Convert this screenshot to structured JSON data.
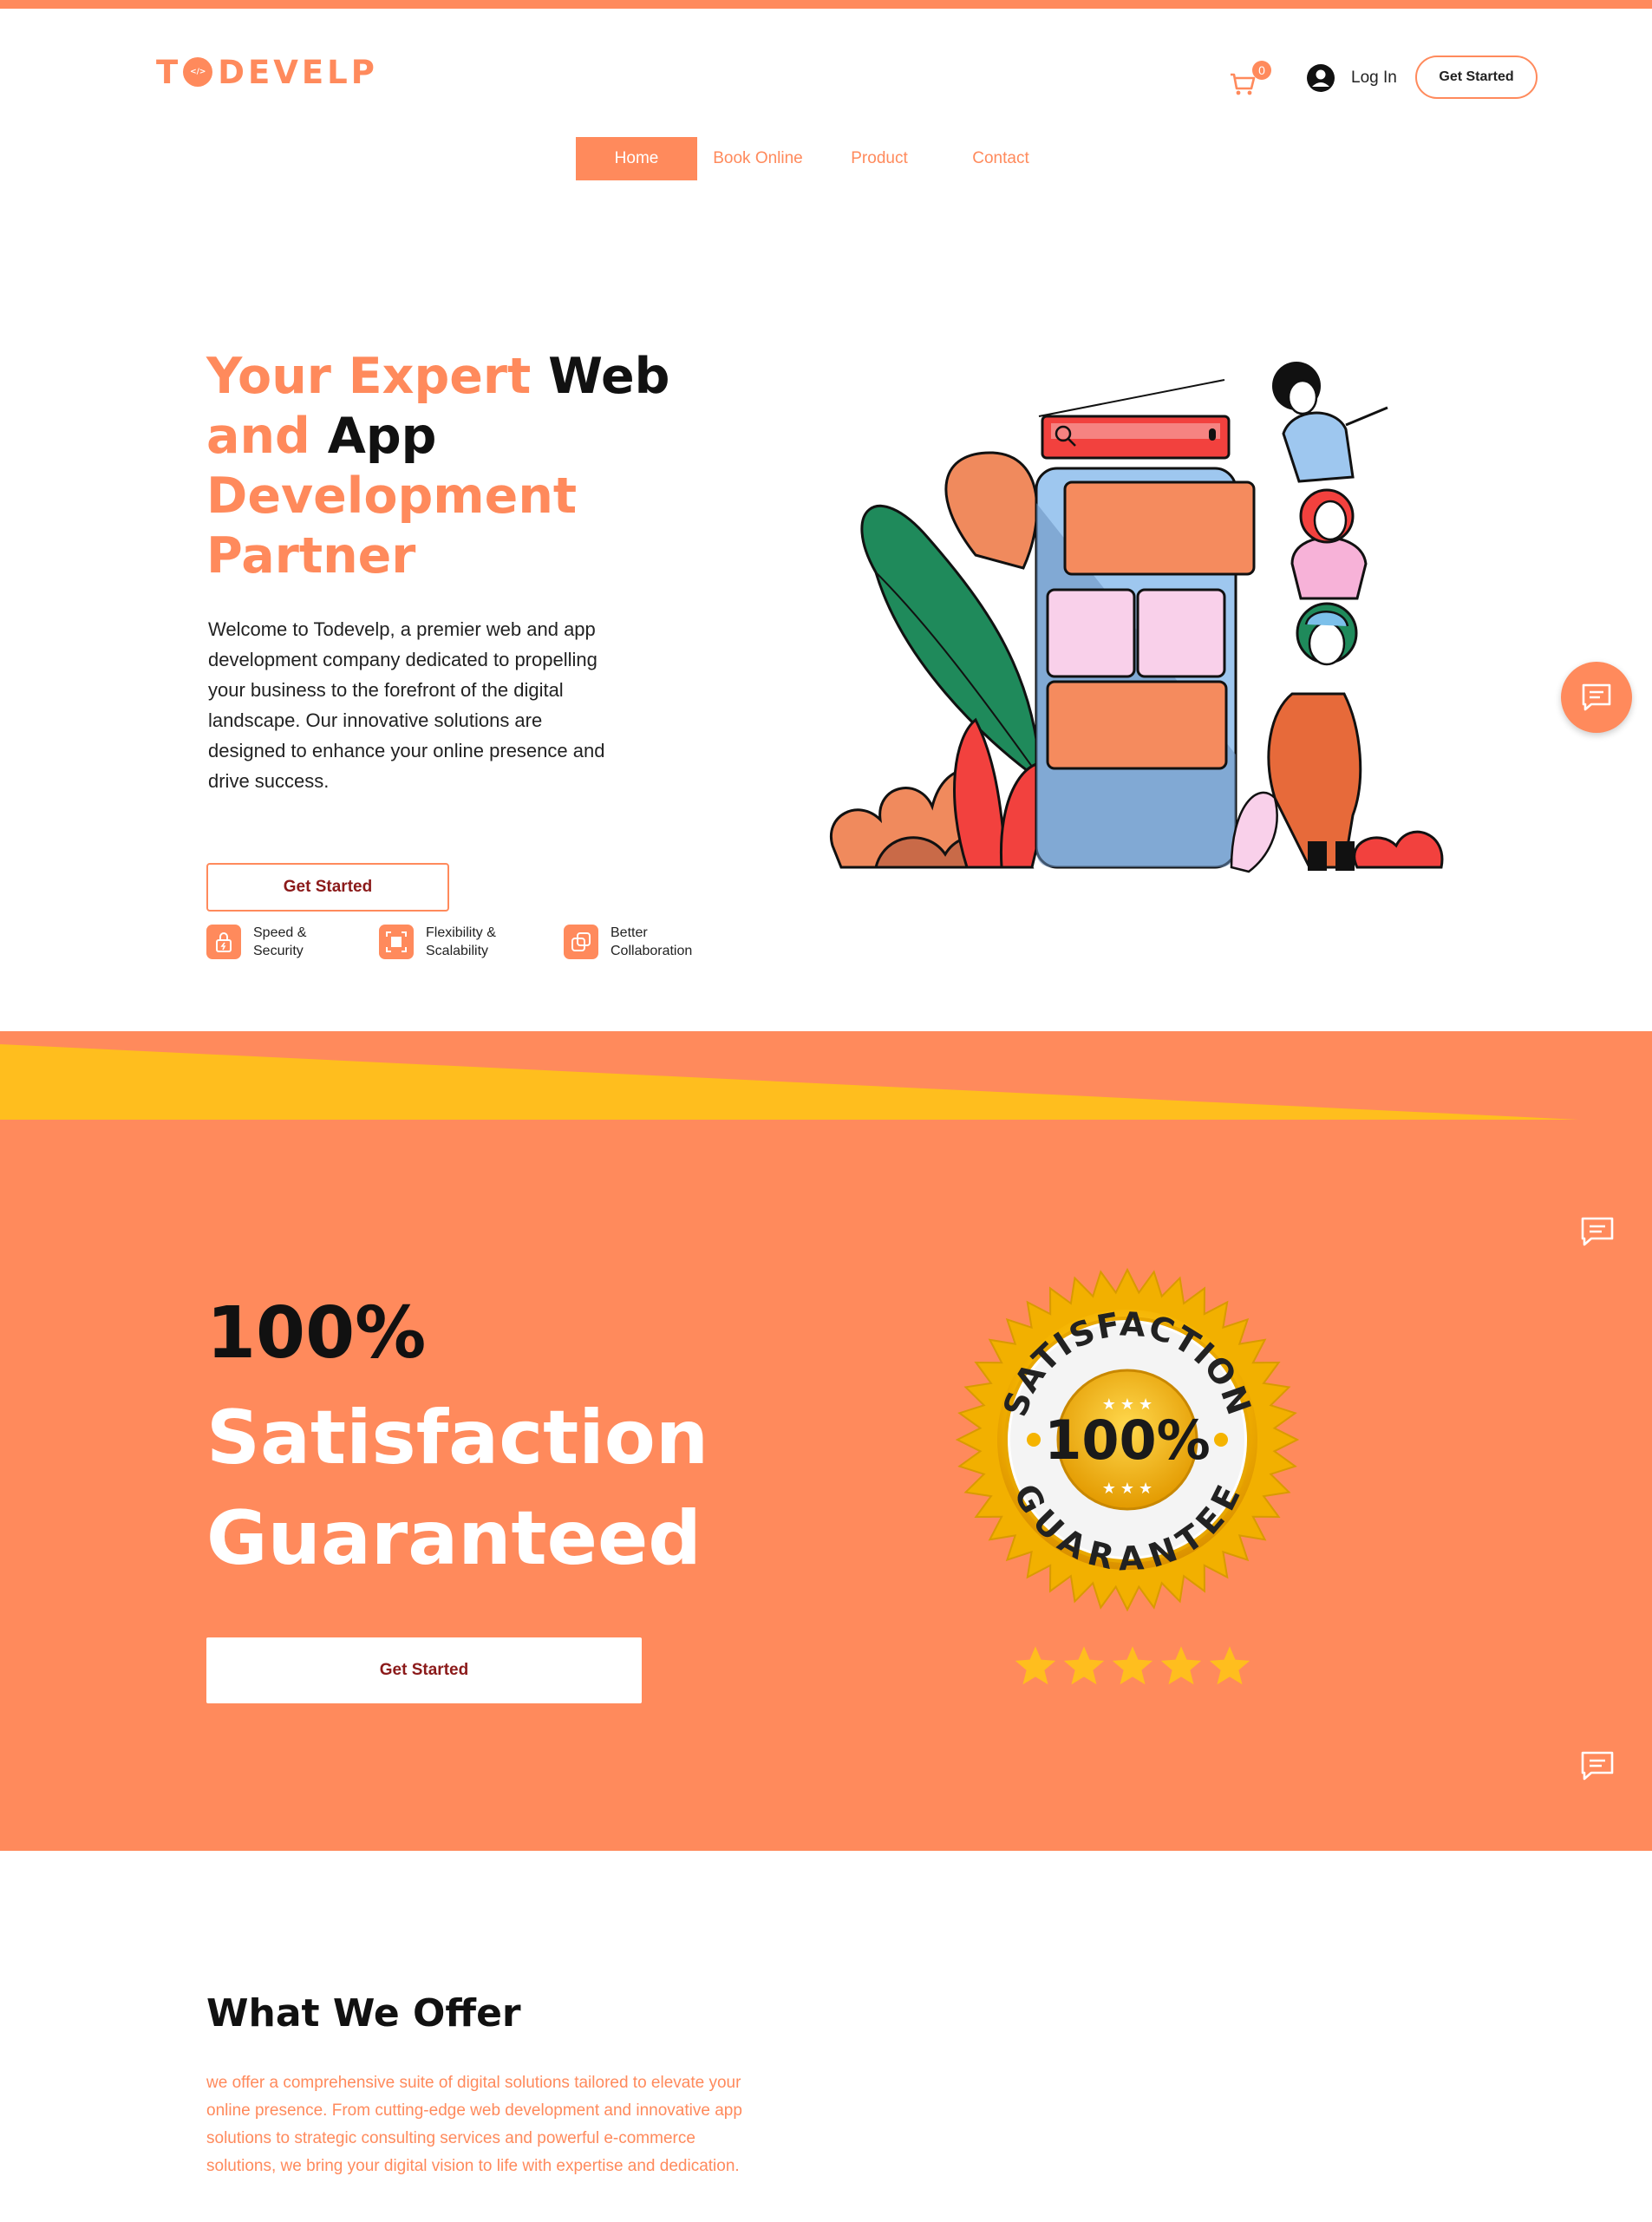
{
  "brand": {
    "logo_prefix": "T",
    "logo_suffix": "DEVELP",
    "logo_mark_text": "</>",
    "accent": "#ff8a5c",
    "yellow": "#ffbe1e"
  },
  "header": {
    "cart_count": "0",
    "login_label": "Log In",
    "cta_label": "Get Started"
  },
  "nav": {
    "items": [
      {
        "label": "Home",
        "active": true
      },
      {
        "label": "Book Online"
      },
      {
        "label": "Product"
      },
      {
        "label": "Contact"
      }
    ]
  },
  "hero": {
    "title_line1_accent": "Your Expert ",
    "title_line1_dark": "Web",
    "title_line2_accent": "and ",
    "title_line2_dark": "App",
    "title_line3": "Development",
    "title_line4": "Partner",
    "intro": "Welcome to Todevelp, a premier web and app development company dedicated to propelling your business to the forefront of the digital landscape. Our innovative solutions are designed to enhance your online presence and drive success.",
    "cta_label": "Get Started",
    "features": [
      {
        "label": "Speed & Security",
        "icon": "lock-icon"
      },
      {
        "label": "Flexibility & Scalability",
        "icon": "expand-icon"
      },
      {
        "label": "Better Collaboration",
        "icon": "collaboration-icon"
      }
    ]
  },
  "satisfaction": {
    "percent": "100%",
    "title_line1": "Satisfaction",
    "title_line2": "Guaranteed",
    "cta_label": "Get Started",
    "seal_top": "SATISFACTION",
    "seal_center": "100%",
    "seal_bottom": "GUARANTEE",
    "stars": 5
  },
  "offer": {
    "title": "What We Offer",
    "text": "we offer a comprehensive suite of digital solutions tailored to elevate your online presence. From cutting-edge web development and innovative app solutions to strategic consulting services and powerful e-commerce solutions, we bring your digital vision to life with expertise and dedication."
  }
}
